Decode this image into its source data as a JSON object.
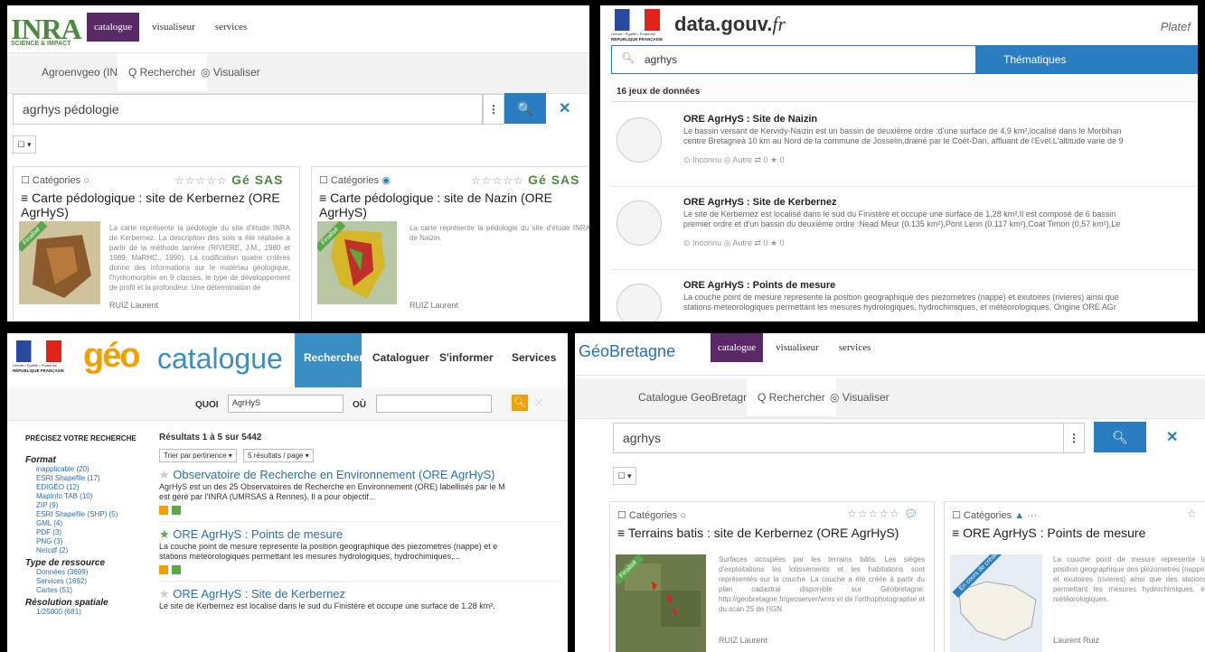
{
  "p1": {
    "logo_main": "INRA",
    "logo_sub": "SCIENCE & IMPACT",
    "nav": [
      "catalogue",
      "visualiseur",
      "services"
    ],
    "sub": [
      "Agroenvgeo (INRA)",
      "Q Rechercher",
      "◎ Visualiser"
    ],
    "search_value": "agrhys pédologie",
    "cards": [
      {
        "cat": "Catégories",
        "stars": "☆☆☆☆☆",
        "brand": "Gé SAS",
        "title": "Carte pédologique : site de Kerbernez (ORE AgrHyS)",
        "desc": "La carte représente la pédologie du site d'étude INRA de Kerbernez. La description des sols a été réalisée à partir de la méthode tarrière (RIVIERE, J.M., 1980 et 1989; MaRHC., 1990). La codification quatre critères donne des informations sur le matériau géologique, l'hydromorphie en 9 classes, le type de développement de profil et la profondeur. Une détermination de",
        "author": "RUIZ Laurent",
        "ribbon": "Finalisé"
      },
      {
        "cat": "Catégories",
        "stars": "☆☆☆☆☆",
        "brand": "Gé SAS",
        "title": "Carte pédologique : site de Nazin (ORE AgrHyS)",
        "desc": "La carte représente la pédologie du site d'étude INRA de Naizin.",
        "author": "RUIZ Laurent",
        "ribbon": "Finalisé"
      }
    ]
  },
  "p2": {
    "title": "data.gouv.",
    "title_tld": "fr",
    "plat": "Platef",
    "search_value": "agrhys",
    "themes": "Thématiques",
    "count": "16 jeux de données",
    "items": [
      {
        "title": "ORE AgrHyS : Site de Naizin",
        "desc1": "Le bassin versant de Kervidy-Naizin est un bassin de deuxième ordre :d'une surface de 4,9 km²,localisé dans le Morbihan",
        "desc2": "centre Bretagneà 10 km au Nord de la commune de Josselin,drainé par le Coët-Dan, affluant de l'Evel.L'altitude varie de 9",
        "meta": "⊙ Inconnu   ◎ Autre   ⇄ 0   ★ 0"
      },
      {
        "title": "ORE AgrHyS : Site de Kerbernez",
        "desc1": "Le site de Kerbernez est localisé dans le sud du Finistère et occupe une surface de 1,28 km².Il est composé de 6 bassin",
        "desc2": "premier ordre et d'un bassin du deuxième ordre :Nead Meur (0.135 km²),Pont Lenn (0.117 km²),Coat Timon (0,57 km²),Le",
        "meta": "⊙ Inconnu   ◎ Autre   ⇄ 0   ★ 0"
      },
      {
        "title": "ORE AgrHyS : Points de mesure",
        "desc1": "La couche point de mesure represente la position geographique des piezometres (nappe) et exutoires (rivieres) ainsi que",
        "desc2": "stations meteorologiques permettant les mesures hydrologiques, hydrochimiques, et météorologiques. Origine ORE AGr",
        "meta": ""
      }
    ],
    "rf1": "Liberté • Égalité • Fraternité",
    "rf2": "RÉPUBLIQUE FRANÇAISE"
  },
  "p3": {
    "logo": "géo",
    "logo2": "catalogue",
    "nav": [
      "Rechercher",
      "Cataloguer",
      "S'informer",
      "Services"
    ],
    "quoi": "QUOI",
    "quoi_value": "AgrHyS",
    "ou": "OÙ",
    "refine": "PRÉCISEZ VOTRE RECHERCHE",
    "results_line": "Résultats 1 à 5 sur 5442",
    "sort": "Trier par pertinence ▾",
    "per_page": "5 résultats / page ▾",
    "facets": [
      {
        "head": "Format",
        "items": [
          "inapplicable (20)",
          "ESRI Shapefile (17)",
          "EDIGÉO (12)",
          "MapInfo TAB (10)",
          "ZIP (9)",
          "ESRI Shapefile (SHP) (5)",
          "GML (4)",
          "PDF (3)",
          "PNG (3)",
          "Netcdf (2)"
        ]
      },
      {
        "head": "Type de ressource",
        "items": [
          "Données (3699)",
          "Services (1692)",
          "Cartes (51)"
        ]
      },
      {
        "head": "Résolution spatiale",
        "items": [
          "1/25000 (681)"
        ]
      }
    ],
    "results": [
      {
        "title": "Observatoire de Recherche en Environnement (ORE AgrHyS)",
        "d1": "AgrHyS est un des 25 Observatoires de Recherche en Environnement (ORE) labellisés par le M",
        "d2": "est géré par l'INRA (UMRSAS à Rennes). Il a pour objectif..."
      },
      {
        "title": "ORE AgrHyS : Points de mesure",
        "d1": "La couche point de mesure represente la position geographique des piezometres (nappe) et e",
        "d2": "stations meteorologiques permettant les mesures hydrologiques, hydrochimiques,..."
      },
      {
        "title": "ORE AgrHyS : Site de Kerbernez",
        "d1": "Le site de Kerbernez est localisé dans le sud du Finistère et occupe une surface de 1.28 km².",
        "d2": ""
      }
    ],
    "rf1": "Liberté • Égalité • Fraternité",
    "rf2": "RÉPUBLIQUE FRANÇAISE"
  },
  "p4": {
    "logo": "GéoBretagne",
    "nav": [
      "catalogue",
      "visualiseur",
      "services"
    ],
    "sub": [
      "Catalogue GeoBretagne",
      "Q Rechercher",
      "◎ Visualiser"
    ],
    "search_value": "agrhys",
    "cards": [
      {
        "cat": "Catégories",
        "stars": "☆☆☆☆☆",
        "title": "Terrains batis : site de Kerbernez (ORE AgrHyS)",
        "desc": "Surfaces occupées par les terrains bâtis. Les sièges d'exploitations les lotissements et les habitations sont représentés sur la couche. La couche a été créée à partir du plan cadastral disponible sur Géobretagne: http://geobretagne.fr/geoserver/wms et de l'orthophotographie et du scan 25 de l'IGN",
        "author": "RUIZ Laurent",
        "ribbon": "Finalisé"
      },
      {
        "cat": "Catégories",
        "stars": "☆",
        "title": "ORE AgrHyS : Points de mesure",
        "desc": "La couche point de mesure represente la position geographique des piezometres (nappe) et exutoires (rivieres) ainsi que des stations permettant les mesures hydrochimiques, et météorologiques.",
        "author": "Laurent Ruiz",
        "ribbon": "En cours de création"
      }
    ]
  }
}
